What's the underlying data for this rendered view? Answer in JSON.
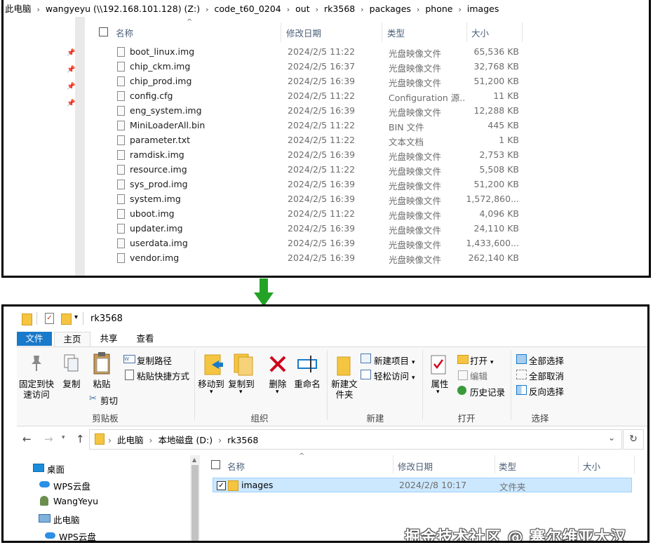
{
  "top_window": {
    "breadcrumb": [
      "此电脑",
      "wangyeyu (\\\\192.168.101.128) (Z:)",
      "code_t60_0204",
      "out",
      "rk3568",
      "packages",
      "phone",
      "images"
    ],
    "columns": {
      "name": "名称",
      "date": "修改日期",
      "type": "类型",
      "size": "大小"
    },
    "files": [
      {
        "name": "boot_linux.img",
        "date": "2024/2/5 11:22",
        "type": "光盘映像文件",
        "size": "65,536 KB"
      },
      {
        "name": "chip_ckm.img",
        "date": "2024/2/5 16:37",
        "type": "光盘映像文件",
        "size": "32,768 KB"
      },
      {
        "name": "chip_prod.img",
        "date": "2024/2/5 16:39",
        "type": "光盘映像文件",
        "size": "51,200 KB"
      },
      {
        "name": "config.cfg",
        "date": "2024/2/5 11:22",
        "type": "Configuration 源...",
        "size": "11 KB"
      },
      {
        "name": "eng_system.img",
        "date": "2024/2/5 16:39",
        "type": "光盘映像文件",
        "size": "12,288 KB"
      },
      {
        "name": "MiniLoaderAll.bin",
        "date": "2024/2/5 11:22",
        "type": "BIN 文件",
        "size": "445 KB"
      },
      {
        "name": "parameter.txt",
        "date": "2024/2/5 11:22",
        "type": "文本文档",
        "size": "1 KB"
      },
      {
        "name": "ramdisk.img",
        "date": "2024/2/5 16:39",
        "type": "光盘映像文件",
        "size": "2,753 KB"
      },
      {
        "name": "resource.img",
        "date": "2024/2/5 11:22",
        "type": "光盘映像文件",
        "size": "5,508 KB"
      },
      {
        "name": "sys_prod.img",
        "date": "2024/2/5 16:39",
        "type": "光盘映像文件",
        "size": "51,200 KB"
      },
      {
        "name": "system.img",
        "date": "2024/2/5 16:39",
        "type": "光盘映像文件",
        "size": "1,572,860..."
      },
      {
        "name": "uboot.img",
        "date": "2024/2/5 11:22",
        "type": "光盘映像文件",
        "size": "4,096 KB"
      },
      {
        "name": "updater.img",
        "date": "2024/2/5 16:39",
        "type": "光盘映像文件",
        "size": "24,110 KB"
      },
      {
        "name": "userdata.img",
        "date": "2024/2/5 16:39",
        "type": "光盘映像文件",
        "size": "1,433,600..."
      },
      {
        "name": "vendor.img",
        "date": "2024/2/5 16:39",
        "type": "光盘映像文件",
        "size": "262,140 KB"
      }
    ]
  },
  "bottom_window": {
    "title": "rk3568",
    "tabs": {
      "file": "文件",
      "home": "主页",
      "share": "共享",
      "view": "查看"
    },
    "ribbon": {
      "pin": "固定到快速访问",
      "copy": "复制",
      "paste": "粘贴",
      "copy_path": "复制路径",
      "paste_shortcut": "粘贴快捷方式",
      "cut": "剪切",
      "clipboard": "剪贴板",
      "move_to": "移动到",
      "copy_to": "复制到",
      "delete": "删除",
      "rename": "重命名",
      "organize": "组织",
      "new_folder": "新建文件夹",
      "new_item": "新建项目",
      "easy_access": "轻松访问",
      "new": "新建",
      "properties": "属性",
      "open": "打开",
      "edit": "编辑",
      "history": "历史记录",
      "open_group": "打开",
      "select_all": "全部选择",
      "select_none": "全部取消",
      "invert": "反向选择",
      "select": "选择"
    },
    "address": [
      "此电脑",
      "本地磁盘 (D:)",
      "rk3568"
    ],
    "nav": [
      "桌面",
      "WPS云盘",
      "WangYeyu",
      "此电脑",
      "WPS云盘"
    ],
    "columns": {
      "name": "名称",
      "date": "修改日期",
      "type": "类型",
      "size": "大小"
    },
    "items": [
      {
        "name": "images",
        "date": "2024/2/8 10:17",
        "type": "文件夹"
      }
    ]
  },
  "watermark": "掘金技术社区 @ 塞尔维亚大汉",
  "colors": {
    "accent": "#1979ca",
    "selected_row": "#cce8ff",
    "arrow": "#22a326",
    "folder": "#f5c542"
  }
}
